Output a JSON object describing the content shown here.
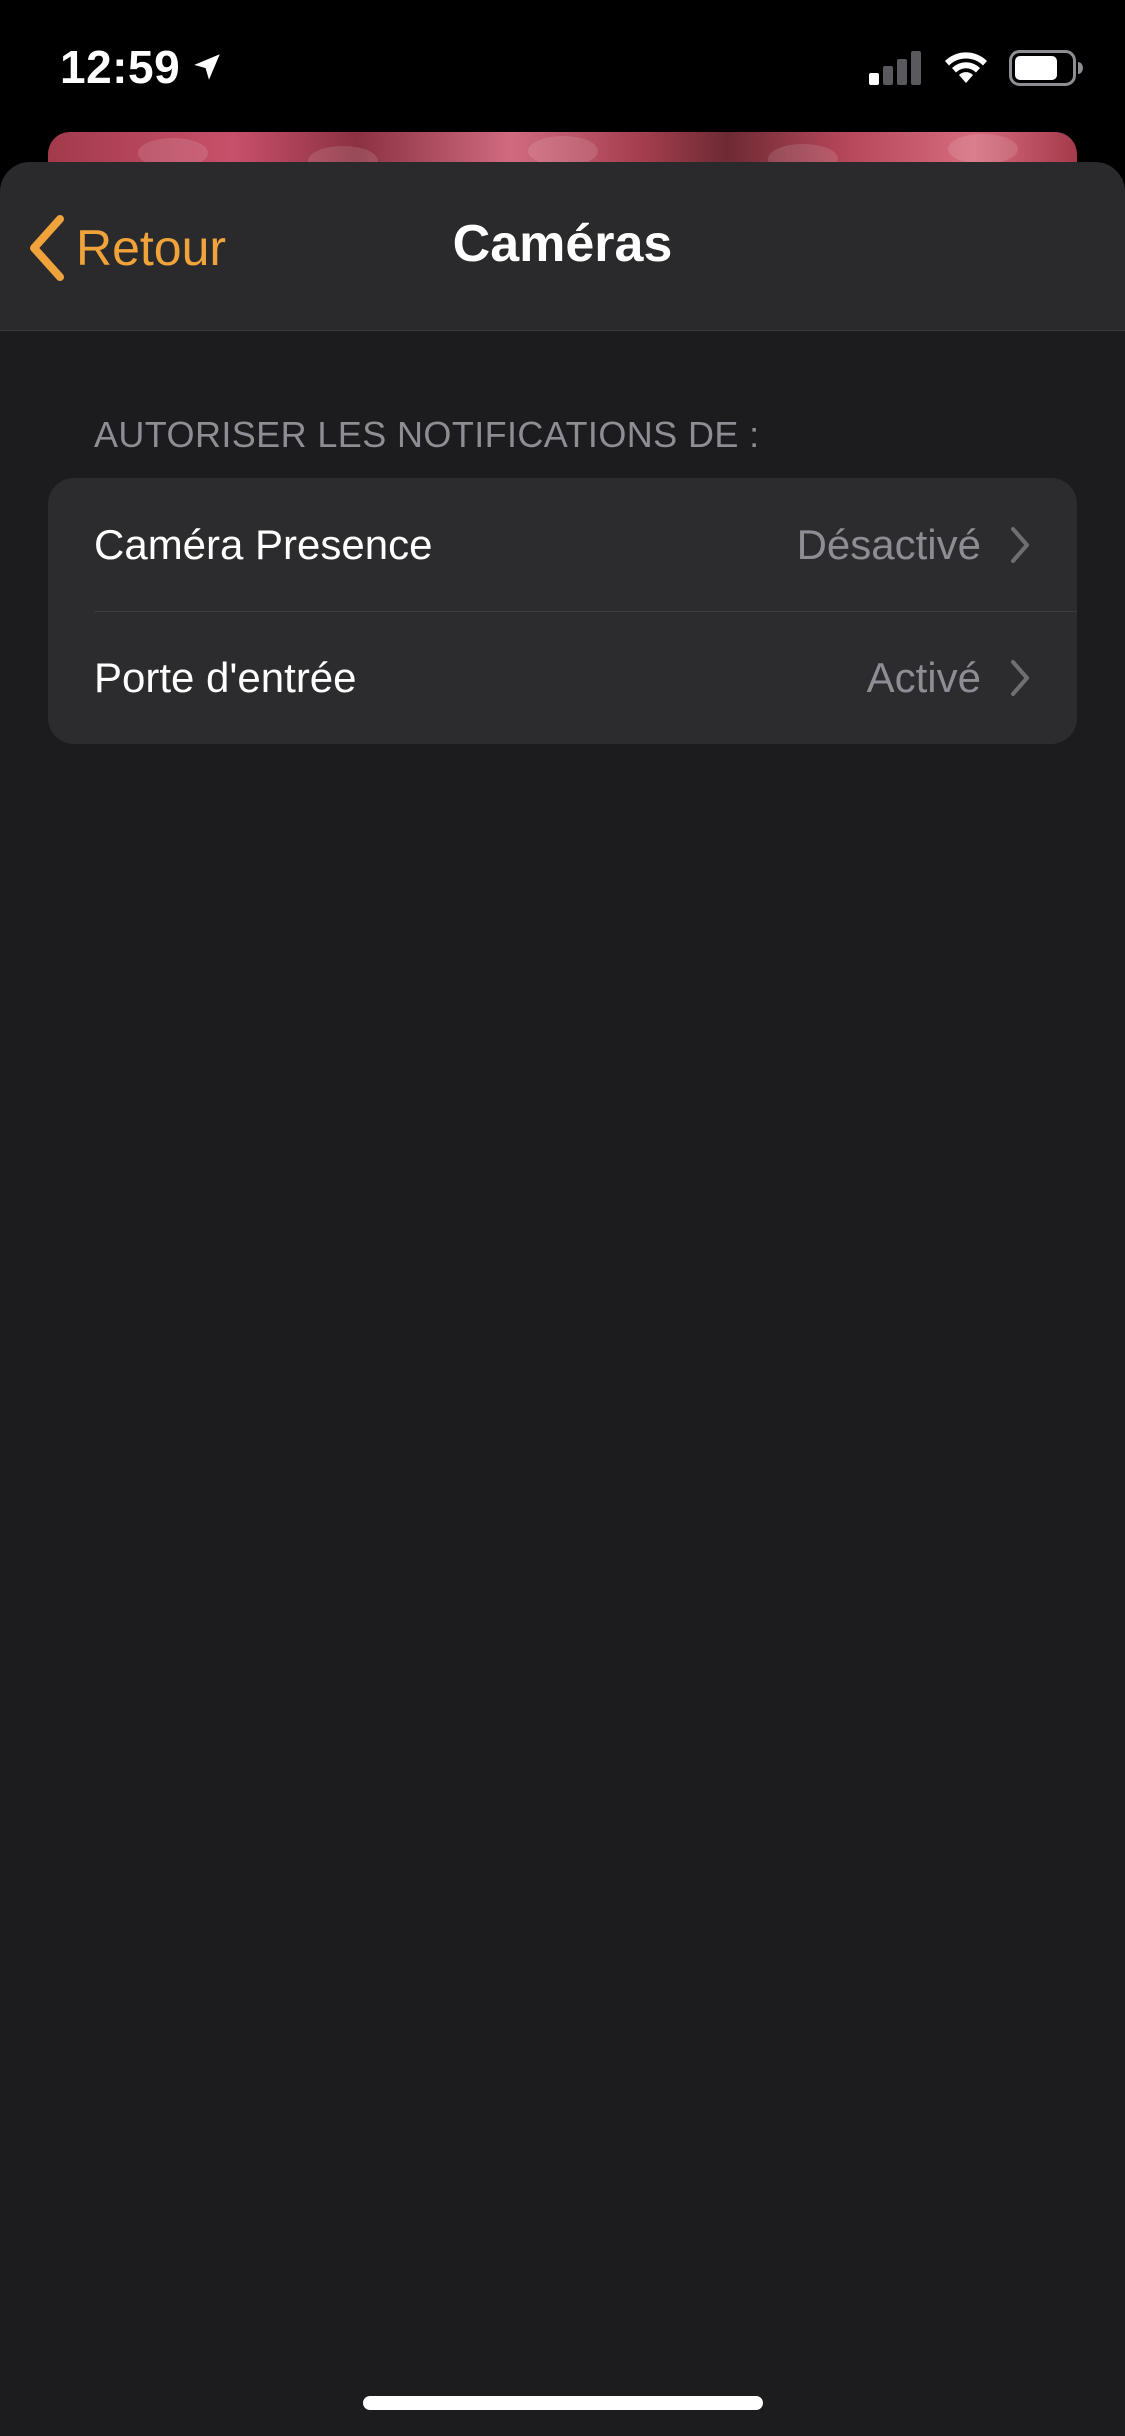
{
  "status_bar": {
    "time": "12:59",
    "location_icon": "location-arrow-icon",
    "signal_icon": "cellular-signal-icon",
    "wifi_icon": "wifi-icon",
    "battery_icon": "battery-icon"
  },
  "nav": {
    "back_label": "Retour",
    "title": "Caméras"
  },
  "section": {
    "header": "AUTORISER LES NOTIFICATIONS DE :"
  },
  "rows": [
    {
      "label": "Caméra Presence",
      "value": "Désactivé"
    },
    {
      "label": "Porte d'entrée",
      "value": "Activé"
    }
  ],
  "colors": {
    "accent": "#f0a33a",
    "background": "#1c1c1e",
    "group_background": "#2c2c2e",
    "secondary_text": "#8d8d93"
  }
}
